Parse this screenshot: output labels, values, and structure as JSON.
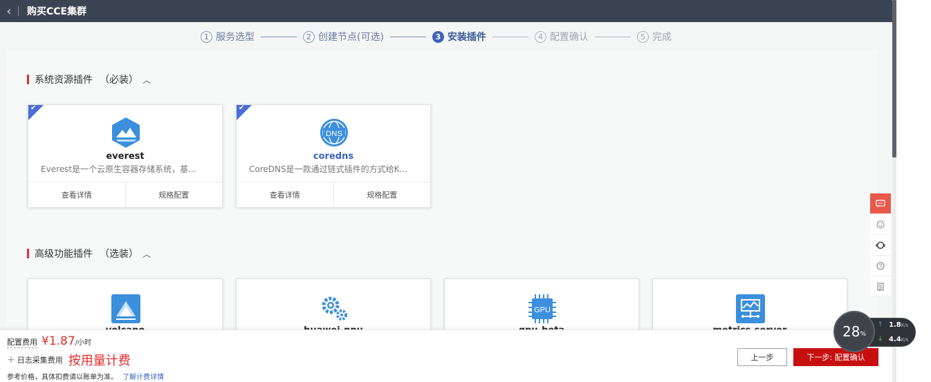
{
  "header": {
    "title": "购买CCE集群"
  },
  "steps": [
    {
      "num": "1",
      "label": "服务选型"
    },
    {
      "num": "2",
      "label": "创建节点(可选)"
    },
    {
      "num": "3",
      "label": "安装插件"
    },
    {
      "num": "4",
      "label": "配置确认"
    },
    {
      "num": "5",
      "label": "完成"
    }
  ],
  "sections": {
    "required": {
      "title": "系统资源插件",
      "tag": "（必装）"
    },
    "optional": {
      "title": "高级功能插件",
      "tag": "（选装）"
    }
  },
  "required_cards": [
    {
      "name": "everest",
      "desc": "Everest是一个云原生容器存储系统，基...",
      "detail": "查看详情",
      "spec": "规格配置",
      "icon": "mountain-hex-icon"
    },
    {
      "name": "coredns",
      "desc": "CoreDNS是一款通过链式插件的方式给K...",
      "detail": "查看详情",
      "spec": "规格配置",
      "icon": "dns-globe-icon"
    }
  ],
  "optional_cards": [
    {
      "name": "volcano",
      "icon": "volcano-icon"
    },
    {
      "name": "huawei-npu",
      "icon": "gears-icon"
    },
    {
      "name": "gpu-beta",
      "icon": "gpu-chip-icon"
    },
    {
      "name": "metrics-server",
      "icon": "metrics-icon"
    }
  ],
  "footer": {
    "config_fee_label": "配置费用",
    "config_fee_value": "¥1.87",
    "config_fee_unit": "/小时",
    "log_fee_label": "日志采集费用",
    "log_fee_value": "按用量计费",
    "note": "参考价格，具体扣费请以账单为准。",
    "note_link": "了解计费详情",
    "prev_label": "上一步",
    "next_label": "下一步: 配置确认"
  },
  "speed_widget": {
    "percent": "28",
    "percent_unit": "%",
    "up": "1.8",
    "down": "4.4",
    "unit": "K/s"
  },
  "colors": {
    "accent": "#3d62b8",
    "danger": "#e02d2d",
    "topbar": "#3b4452",
    "next_button": "#c70f0f"
  }
}
